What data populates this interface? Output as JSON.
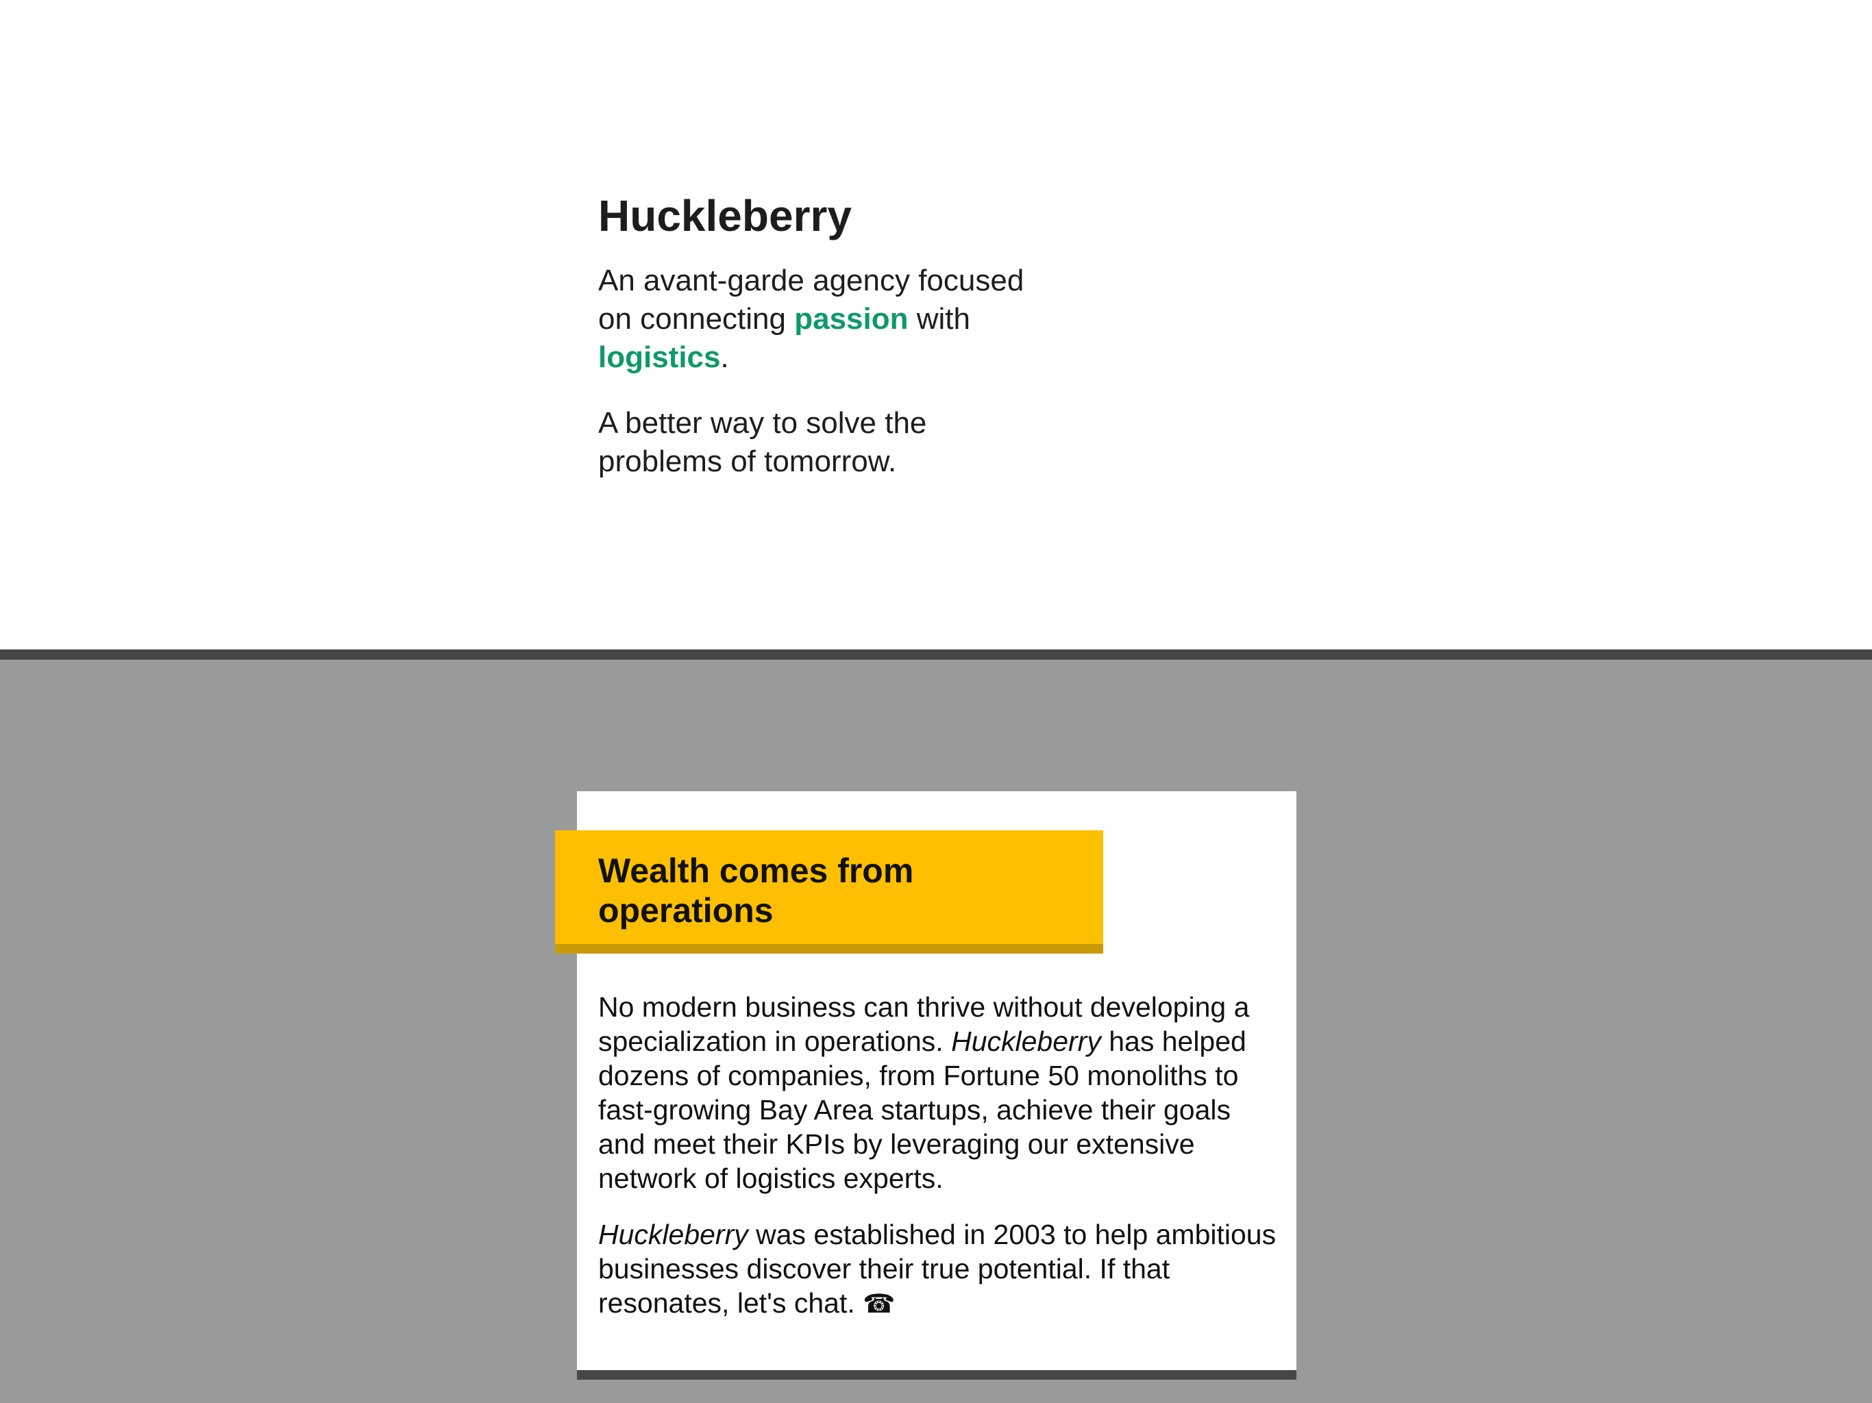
{
  "hero": {
    "title": "Huckleberry",
    "tagline_part1": "An avant-garde agency focused on connecting ",
    "tagline_accent1": "passion",
    "tagline_part2": " with ",
    "tagline_accent2": "logistics",
    "tagline_part3": ".",
    "subline": "A better way to solve the problems of tomorrow."
  },
  "card": {
    "banner_title": "Wealth comes from operations",
    "p1_part1": "No modern business can thrive without developing a specialization in operations. ",
    "p1_brand": "Huckleberry",
    "p1_part2": " has helped dozens of companies, from Fortune 50 monoliths to fast-growing Bay Area startups, achieve their goals and meet their KPIs by leveraging our extensive network of logistics experts.",
    "p2_brand": "Huckleberry",
    "p2_part1": " was established in 2003 to help ambitious businesses discover their true potential. If that resonates, let's chat. ",
    "phone_glyph": "☎"
  },
  "colors": {
    "accent": "#0e9a68",
    "banner": "#fdbf00",
    "banner_shadow": "#c99b0a",
    "divider": "#474747",
    "lower_bg": "#9a9a9a"
  },
  "icons": {
    "phone": "phone-icon"
  }
}
